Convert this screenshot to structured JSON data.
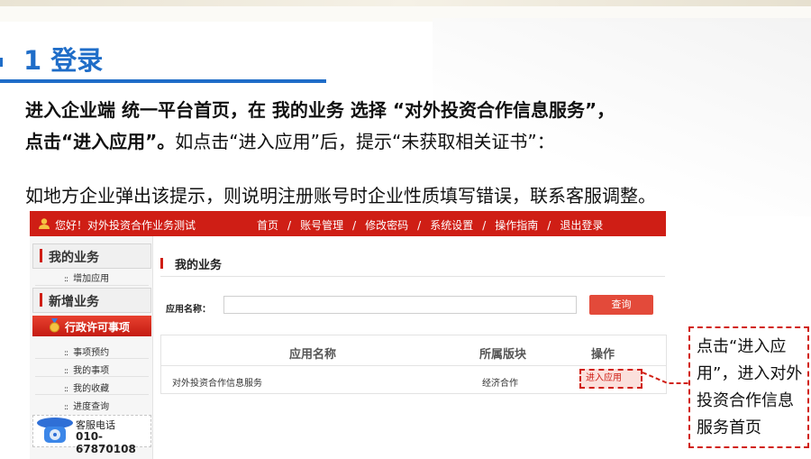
{
  "slide": {
    "title": "1 登录",
    "line1_bold": "进入企业端 统一平台首页，在 我的业务 选择 “对外投资合作信息服务”，",
    "line2_bold": "点击“进入应用”。",
    "line2_normal": "如点击“进入应用”后，提示“未获取相关证书”：",
    "line3": "如地方企业弹出该提示，则说明注册账号时企业性质填写错误，联系客服调整。"
  },
  "app": {
    "greeting": "您好！对外投资合作业务测试",
    "nav": [
      "首页",
      "账号管理",
      "修改密码",
      "系统设置",
      "操作指南",
      "退出登录"
    ],
    "nav_sep": "/",
    "sidebar": {
      "group1": "我的业务",
      "group1_items": [
        "增加应用"
      ],
      "group2": "新增业务",
      "active": "行政许可事项",
      "items": [
        "事项预约",
        "我的事项",
        "我的收藏",
        "进度查询"
      ],
      "dots": "::"
    },
    "service": {
      "label": "客服电话",
      "phone": "010-67870108"
    },
    "main": {
      "heading": "我的业务",
      "search_label": "应用名称：",
      "search_value": "",
      "search_button": "查询",
      "columns": [
        "应用名称",
        "所属版块",
        "操作"
      ],
      "row": {
        "name": "对外投资合作信息服务",
        "section": "经济合作",
        "action": "进入应用"
      }
    }
  },
  "callout": "点击“进入应用”，进入对外投资合作信息服务首页",
  "colors": {
    "accent_blue": "#1f6dc8",
    "app_red": "#cf1e15",
    "highlight_red": "#d11f13"
  }
}
